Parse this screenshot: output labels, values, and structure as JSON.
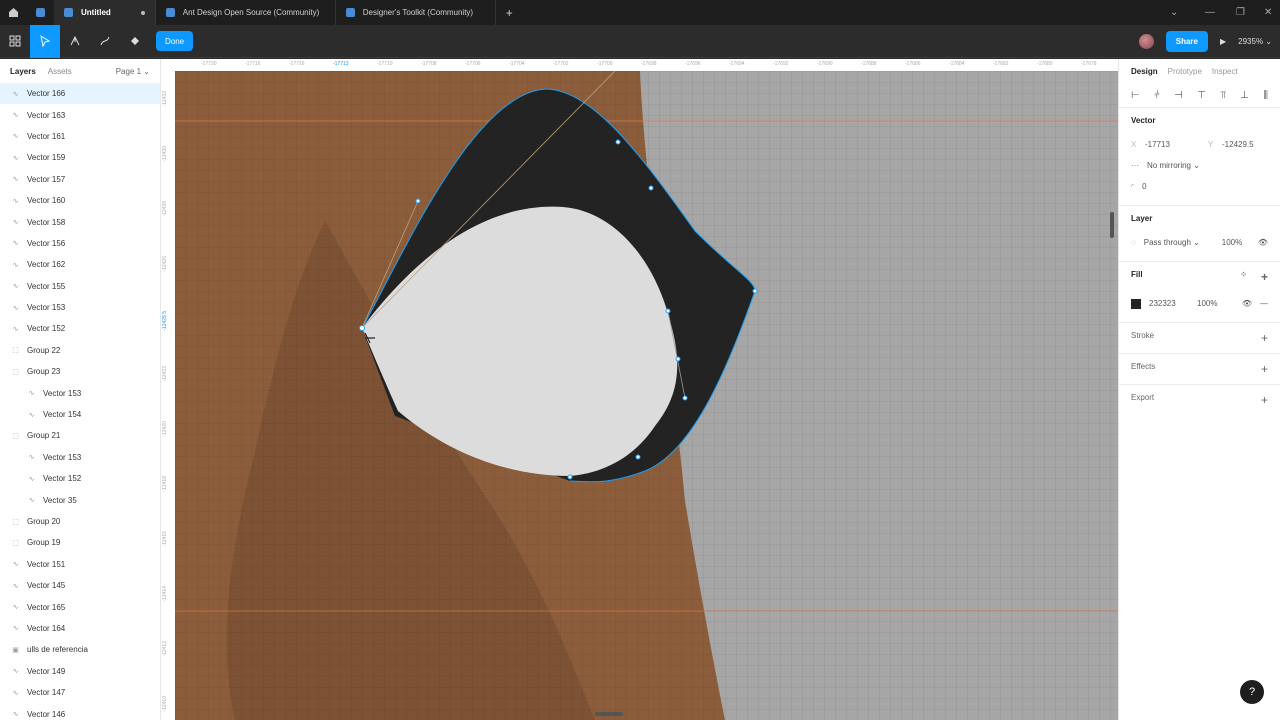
{
  "tabs": [
    {
      "label": "Untitled",
      "active": true
    },
    {
      "label": "Ant Design Open Source (Community)",
      "active": false
    },
    {
      "label": "Designer's Toolkit (Community)",
      "active": false
    }
  ],
  "toolbar": {
    "done_label": "Done",
    "share_label": "Share",
    "zoom": "2935%"
  },
  "layers_panel": {
    "tab_layers": "Layers",
    "tab_assets": "Assets",
    "page": "Page 1",
    "items": [
      {
        "name": "Vector 166",
        "icon": "vector-icon",
        "indent": 0,
        "selected": true
      },
      {
        "name": "Vector 163",
        "icon": "vector-icon",
        "indent": 0
      },
      {
        "name": "Vector 161",
        "icon": "vector-icon",
        "indent": 0
      },
      {
        "name": "Vector 159",
        "icon": "vector-icon",
        "indent": 0
      },
      {
        "name": "Vector 157",
        "icon": "vector-icon",
        "indent": 0
      },
      {
        "name": "Vector 160",
        "icon": "vector-icon",
        "indent": 0
      },
      {
        "name": "Vector 158",
        "icon": "vector-icon",
        "indent": 0
      },
      {
        "name": "Vector 156",
        "icon": "vector-icon",
        "indent": 0
      },
      {
        "name": "Vector 162",
        "icon": "vector-icon",
        "indent": 0
      },
      {
        "name": "Vector 155",
        "icon": "vector-icon",
        "indent": 0
      },
      {
        "name": "Vector 153",
        "icon": "vector-icon",
        "indent": 0
      },
      {
        "name": "Vector 152",
        "icon": "vector-icon",
        "indent": 0
      },
      {
        "name": "Group 22",
        "icon": "group-icon",
        "indent": 0
      },
      {
        "name": "Group 23",
        "icon": "group-icon",
        "indent": 0
      },
      {
        "name": "Vector 153",
        "icon": "vector-icon",
        "indent": 1
      },
      {
        "name": "Vector 154",
        "icon": "vector-icon",
        "indent": 1
      },
      {
        "name": "Group 21",
        "icon": "group-icon",
        "indent": 0
      },
      {
        "name": "Vector 153",
        "icon": "vector-icon",
        "indent": 1
      },
      {
        "name": "Vector 152",
        "icon": "vector-icon",
        "indent": 1
      },
      {
        "name": "Vector 35",
        "icon": "vector-icon",
        "indent": 1
      },
      {
        "name": "Group 20",
        "icon": "group-icon",
        "indent": 0
      },
      {
        "name": "Group 19",
        "icon": "group-icon",
        "indent": 0
      },
      {
        "name": "Vector 151",
        "icon": "vector-icon",
        "indent": 0
      },
      {
        "name": "Vector 145",
        "icon": "vector-icon",
        "indent": 0
      },
      {
        "name": "Vector 165",
        "icon": "vector-icon",
        "indent": 0
      },
      {
        "name": "Vector 164",
        "icon": "vector-icon",
        "indent": 0
      },
      {
        "name": "ulls de referencia",
        "icon": "image-icon",
        "indent": 0
      },
      {
        "name": "Vector 149",
        "icon": "vector-icon",
        "indent": 0
      },
      {
        "name": "Vector 147",
        "icon": "vector-icon",
        "indent": 0
      },
      {
        "name": "Vector 146",
        "icon": "vector-icon",
        "indent": 0
      }
    ]
  },
  "canvas": {
    "ruler_top": [
      "-17720",
      "-17716",
      "-17716",
      "-17713",
      "-17710",
      "-17708",
      "-17706",
      "-17704",
      "-17702",
      "-17700",
      "-17698",
      "-17696",
      "-17694",
      "-17692",
      "-17690",
      "-17688",
      "-17686",
      "-17684",
      "-17682",
      "-17680",
      "-17678"
    ],
    "ruler_left": [
      "-12432",
      "-12430",
      "-12428",
      "-12426",
      "-12429.5",
      "-12422",
      "-12420",
      "-12418",
      "-12416",
      "-12414",
      "-12412",
      "-12410"
    ],
    "colors": {
      "skin": "#8b5d3b",
      "shadow": "#7a4f33",
      "gray": "#a6a6a6",
      "fill": "#232323",
      "white": "#dcdcdc",
      "handle": "#18a0fb"
    }
  },
  "design_panel": {
    "tabs": [
      "Design",
      "Prototype",
      "Inspect"
    ],
    "vector_title": "Vector",
    "x_label": "X",
    "x_value": "-17713",
    "y_label": "Y",
    "y_value": "-12429.5",
    "mirroring": "No mirroring",
    "corner": "0",
    "layer_title": "Layer",
    "blend": "Pass through",
    "layer_opacity": "100%",
    "fill_title": "Fill",
    "fill_hex": "232323",
    "fill_opacity": "100%",
    "stroke_title": "Stroke",
    "effects_title": "Effects",
    "export_title": "Export",
    "help": "?"
  }
}
